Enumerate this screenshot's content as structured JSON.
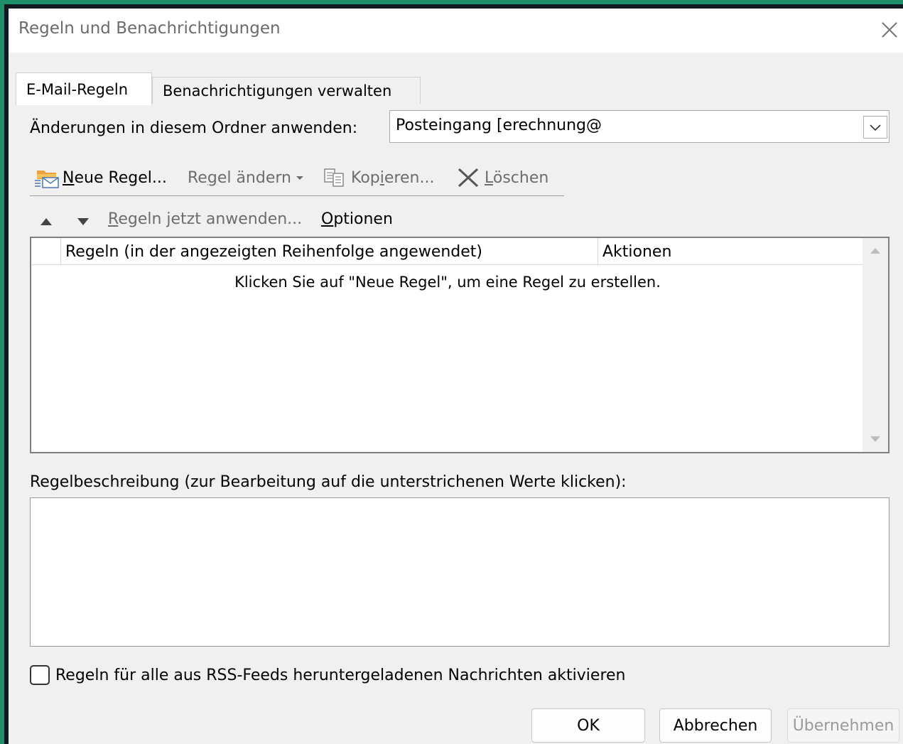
{
  "window": {
    "title": "Regeln und Benachrichtigungen",
    "close_glyph": "✕"
  },
  "tabs": [
    {
      "label": "E-Mail-Regeln",
      "active": true
    },
    {
      "label": "Benachrichtigungen verwalten",
      "active": false
    }
  ],
  "folder": {
    "label": "Änderungen in diesem Ordner anwenden:",
    "value": "Posteingang [erechnung@"
  },
  "toolbar": {
    "new_rule": {
      "pre": "",
      "ul": "N",
      "post": "eue Regel..."
    },
    "change_rule": {
      "pre": "Re",
      "ul": "g",
      "post": "el ändern"
    },
    "copy": {
      "pre": "Kop",
      "ul": "i",
      "post": "eren..."
    },
    "delete": {
      "pre": "",
      "ul": "L",
      "post": "öschen"
    }
  },
  "actions": {
    "apply_now": {
      "pre": "",
      "ul": "R",
      "post": "egeln jetzt anwenden..."
    },
    "options": {
      "pre": "",
      "ul": "O",
      "post": "ptionen"
    }
  },
  "rules_list": {
    "columns": [
      "Regeln (in der angezeigten Reihenfolge angewendet)",
      "Aktionen"
    ],
    "empty_message": "Klicken Sie auf \"Neue Regel\", um eine Regel zu erstellen."
  },
  "description": {
    "label": "Regelbeschreibung (zur Bearbeitung auf die unterstrichenen Werte klicken):"
  },
  "rss": {
    "label": "Regeln für alle aus RSS-Feeds heruntergeladenen Nachrichten aktivieren",
    "checked": false
  },
  "buttons": {
    "ok": "OK",
    "cancel": "Abbrechen",
    "apply": "Übernehmen"
  },
  "colors": {
    "accent_frame": "#1f8f6a",
    "dialog_bg": "#f0f0f0",
    "disabled_text": "#6d6d6d"
  },
  "icons": {
    "new_rule": "new-rule-envelope-icon",
    "change_rule_dropdown": "chevron-down-icon",
    "copy": "copy-icon",
    "delete": "delete-x-icon",
    "move_up": "triangle-up-icon",
    "move_down": "triangle-down-icon"
  }
}
